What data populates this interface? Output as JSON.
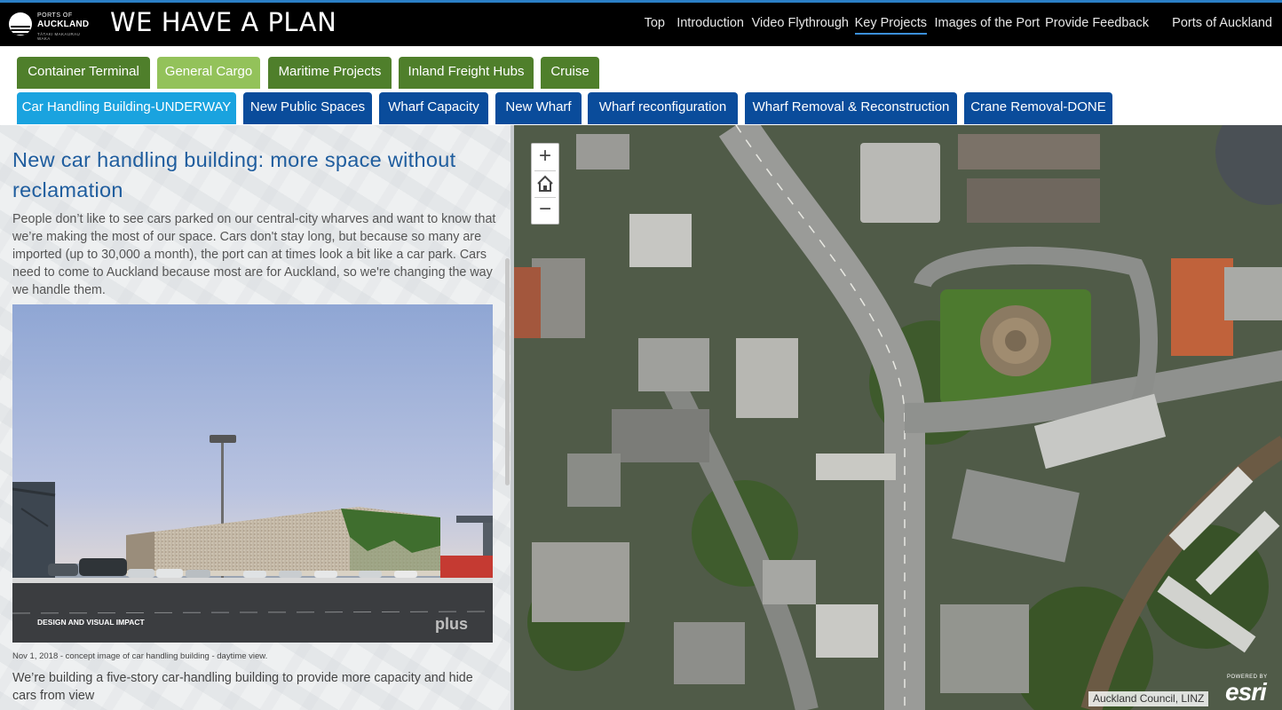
{
  "header": {
    "logo": {
      "line1": "PORTS OF",
      "line2": "AUCKLAND",
      "line3": "TĀTAKI MAKAURAU WAKA"
    },
    "title": "WE HAVE A PLAN",
    "nav": [
      {
        "label": "Top",
        "active": false
      },
      {
        "label": "Introduction",
        "active": false
      },
      {
        "label": "Video Flythrough",
        "active": false
      },
      {
        "label": "Key Projects",
        "active": true
      },
      {
        "label": "Images of the Port",
        "active": false
      },
      {
        "label": "Provide Feedback",
        "active": false
      },
      {
        "label": "Ports of Auckland",
        "active": false
      }
    ]
  },
  "tabs_row1": [
    {
      "label": "Container Terminal",
      "active": false
    },
    {
      "label": "General Cargo",
      "active": true
    },
    {
      "label": "Maritime Projects",
      "active": false
    },
    {
      "label": "Inland Freight Hubs",
      "active": false
    },
    {
      "label": "Cruise",
      "active": false
    }
  ],
  "tabs_row2": [
    {
      "label": "Car Handling Building-UNDERWAY",
      "active": true
    },
    {
      "label": "New Public Spaces",
      "active": false
    },
    {
      "label": "Wharf Capacity",
      "active": false
    },
    {
      "label": "New Wharf",
      "active": false
    },
    {
      "label": "Wharf reconfiguration",
      "active": false
    },
    {
      "label": "Wharf Removal & Reconstruction",
      "active": false
    },
    {
      "label": "Crane Removal-DONE",
      "active": false
    }
  ],
  "panel": {
    "heading": "New car handling building: more space without reclamation",
    "paragraph": "People don’t like to see cars parked on our central-city wharves and want to know that we’re making the most of our space. Cars don't stay long, but because so many are imported (up to 30,000 a month), the port can at times look a bit like a car park. Cars need to come to Auckland because most are for Auckland, so we're changing the way we handle them.",
    "image": {
      "overlay_left": "DESIGN AND VISUAL IMPACT",
      "overlay_right": "plus"
    },
    "caption": "Nov 1, 2018 - concept image of car handling building - daytime view.",
    "paragraph2": "We’re building a five-story car-handling building to provide more capacity and hide cars from view"
  },
  "map": {
    "zoom_in": "+",
    "home_icon": "home-icon",
    "zoom_out": "−",
    "attribution": "Auckland Council, LINZ",
    "powered_by": "POWERED BY",
    "esri": "esri"
  },
  "colors": {
    "tab_green": "#4f7f2b",
    "tab_green_active": "#93c25a",
    "tab_blue": "#0a4c9b",
    "tab_blue_active": "#1aa3df",
    "heading_blue": "#1f5d9e"
  }
}
